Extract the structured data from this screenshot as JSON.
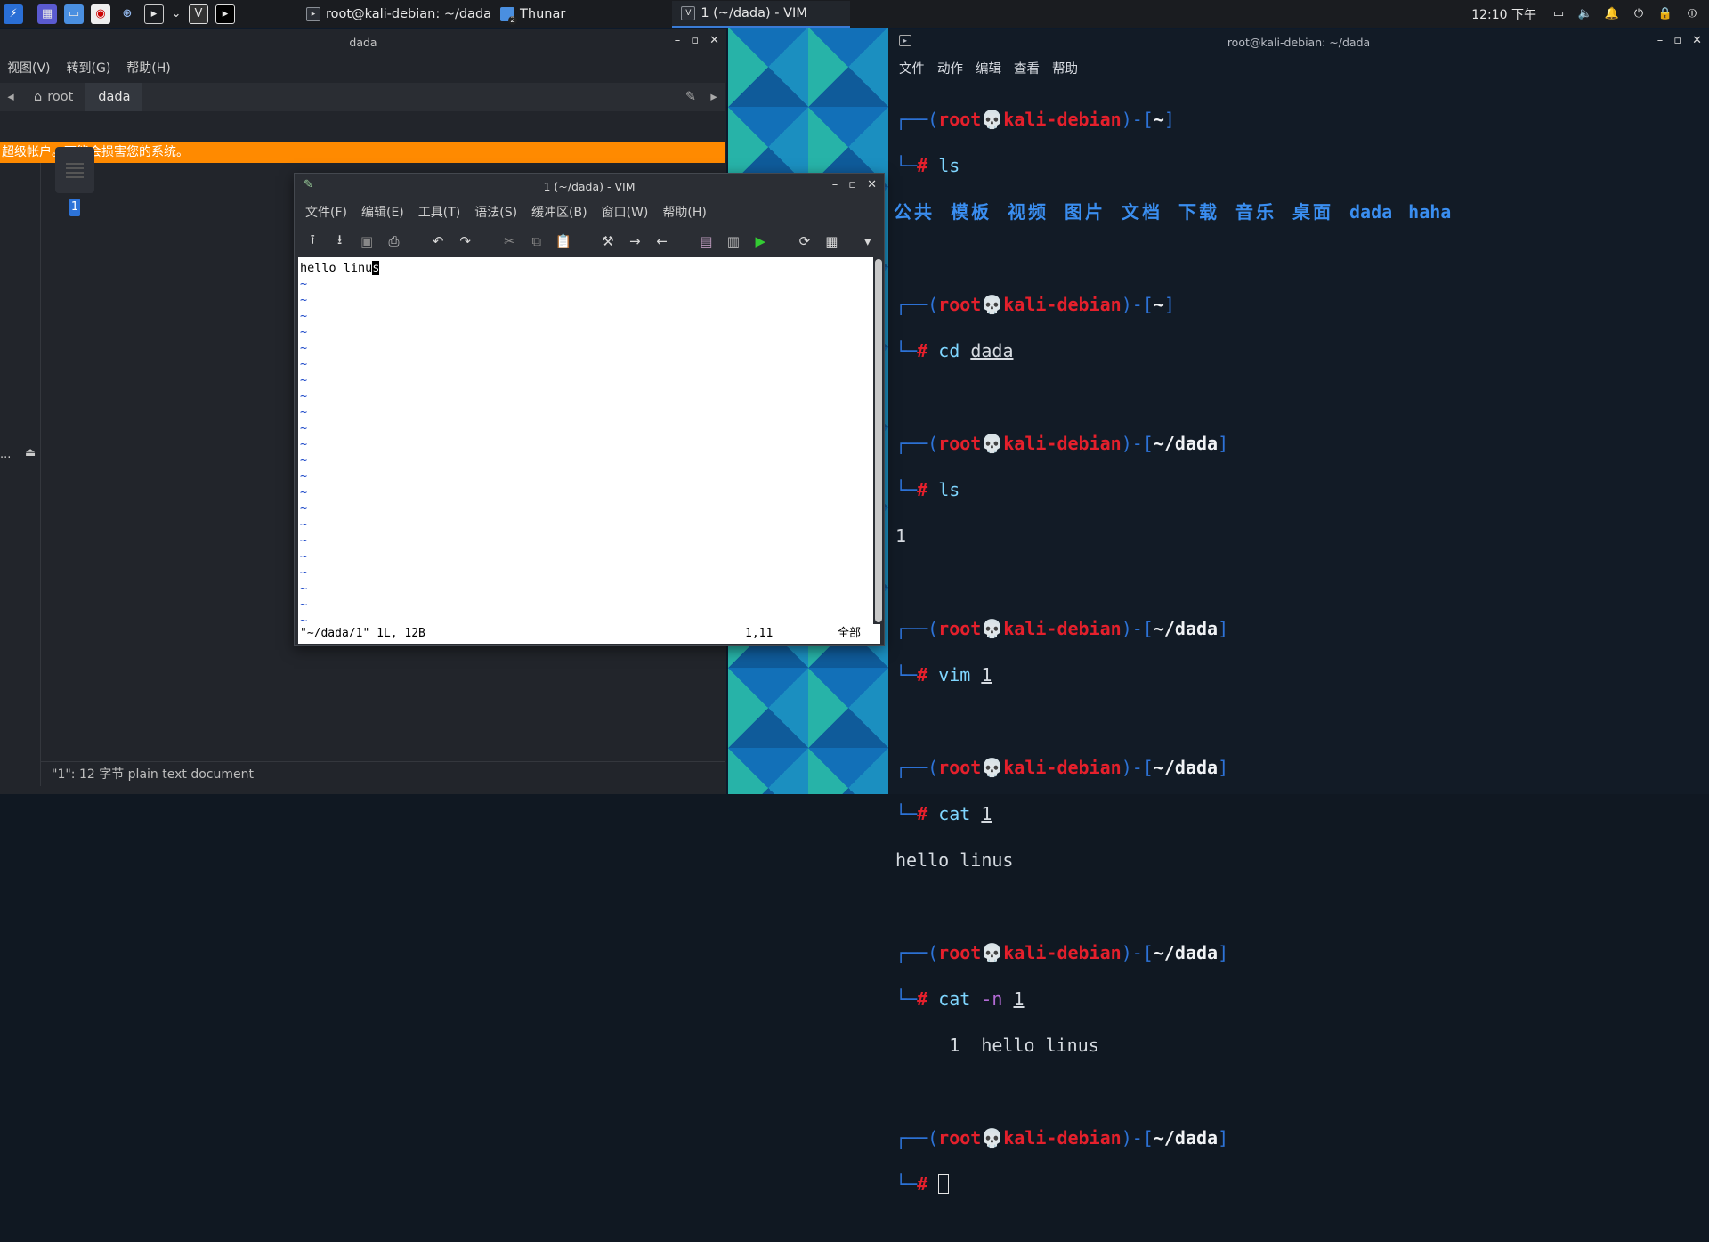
{
  "panel": {
    "tasks": [
      {
        "label": "root@kali-debian: ~/dada"
      },
      {
        "label": "Thunar",
        "badge": "2"
      },
      {
        "label": "1 (~/dada) - VIM"
      }
    ],
    "clock": "12:10 下午"
  },
  "thunar": {
    "title": "dada",
    "menu": [
      "视图(V)",
      "转到(G)",
      "帮助(H)"
    ],
    "path": [
      "root",
      "dada"
    ],
    "warning": "超级帐户。可能会损害您的系统。",
    "file_label": "1",
    "side_label": "...",
    "status": "\"1\": 12 字节 plain text document"
  },
  "vim": {
    "title": "1 (~/dada) - VIM",
    "menu": [
      "文件(F)",
      "编辑(E)",
      "工具(T)",
      "语法(S)",
      "缓冲区(B)",
      "窗口(W)",
      "帮助(H)"
    ],
    "line1_pre": "hello linu",
    "line1_cursor": "s",
    "status_left": "\"~/dada/1\" 1L, 12B",
    "status_pos": "1,11",
    "status_right": "全部"
  },
  "terminal": {
    "title": "root@kali-debian: ~/dada",
    "menu": [
      "文件",
      "动作",
      "编辑",
      "查看",
      "帮助"
    ],
    "user": "root",
    "host": "kali-debian",
    "home": "~",
    "dir": "~/dada",
    "cmds": {
      "ls": "ls",
      "cd": "cd",
      "cd_arg": "dada",
      "vim": "vim",
      "cat": "cat",
      "flag": "-n",
      "arg1": "1"
    },
    "ls_home": [
      "公共",
      "模板",
      "视频",
      "图片",
      "文档",
      "下载",
      "音乐",
      "桌面",
      "dada",
      "haha"
    ],
    "ls_dada": "1",
    "cat_out": "hello linus",
    "catn_out": "     1  hello linus"
  }
}
